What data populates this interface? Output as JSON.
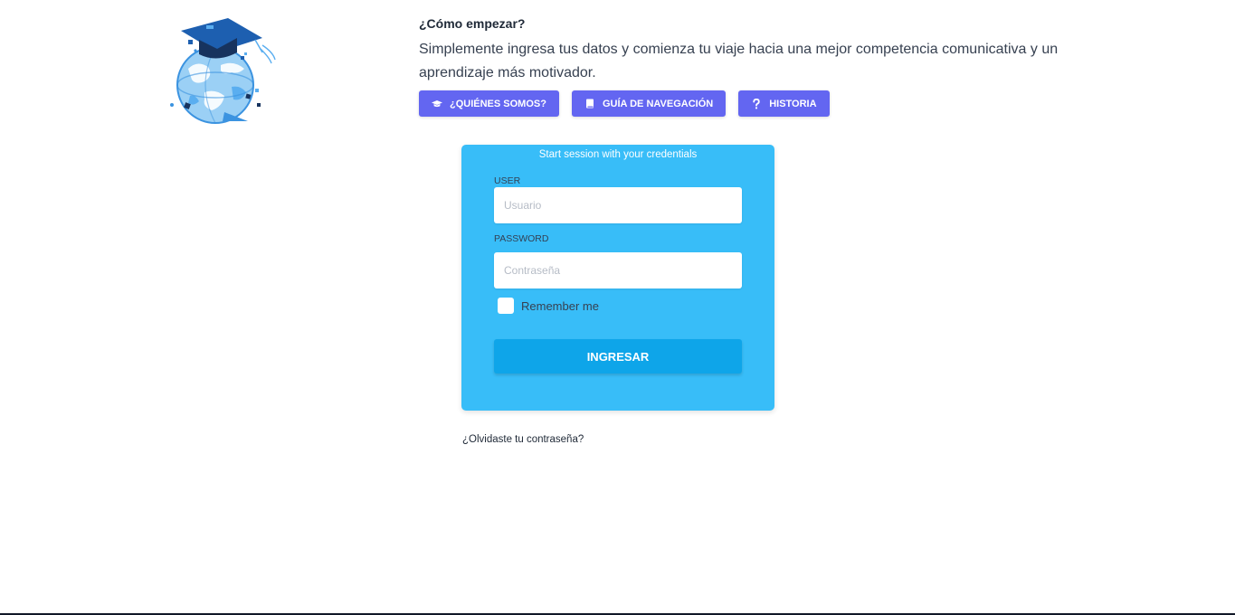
{
  "header": {
    "logo_icon": "graduation-cap-globe-icon"
  },
  "intro": {
    "heading": "¿Cómo empezar?",
    "text": "Simplemente ingresa tus datos y comienza tu viaje hacia una mejor competencia comunicativa y un aprendizaje más motivador."
  },
  "nav_buttons": [
    {
      "label": "¿QUIÉNES SOMOS?",
      "icon": "graduation-cap-icon"
    },
    {
      "label": "GUÍA DE NAVEGACIÓN",
      "icon": "book-icon"
    },
    {
      "label": "HISTORIA",
      "icon": "question-icon"
    }
  ],
  "login": {
    "title": "Start session with your credentials",
    "user_label": "USER",
    "user_placeholder": "Usuario",
    "user_value": "",
    "password_label": "PASSWORD",
    "password_placeholder": "Contraseña",
    "password_value": "",
    "remember_label": "Remember me",
    "remember_checked": false,
    "submit_label": "INGRESAR"
  },
  "forgot_password": "¿Olvidaste tu contraseña?",
  "colors": {
    "primary_button": "#6366f1",
    "card_background": "#38bdf8",
    "submit_button": "#0ea5e9"
  }
}
